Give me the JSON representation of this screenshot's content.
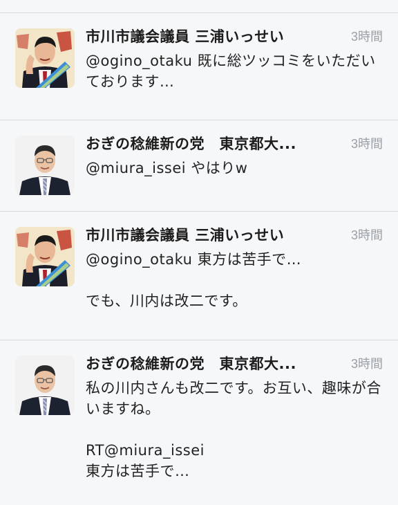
{
  "tweets": [
    {
      "author": "市川市議会議員 三浦いっせい",
      "time": "3時間",
      "text": "@ogino_otaku 既に総ツッコミをいただいております…",
      "avatar_icon": "miura-avatar"
    },
    {
      "author": "おぎの稔維新の党　東京都大...",
      "time": "3時間",
      "text": "@miura_issei やはりw",
      "avatar_icon": "ogino-avatar"
    },
    {
      "author": "市川市議会議員 三浦いっせい",
      "time": "3時間",
      "text": "@ogino_otaku 東方は苦手で…\n\nでも、川内は改二です。",
      "avatar_icon": "miura-avatar"
    },
    {
      "author": "おぎの稔維新の党　東京都大...",
      "time": "3時間",
      "text": "私の川内さんも改二です。お互い、趣味が合いますね。\n\nRT@miura_issei\n東方は苦手で…",
      "avatar_icon": "ogino-avatar"
    }
  ]
}
